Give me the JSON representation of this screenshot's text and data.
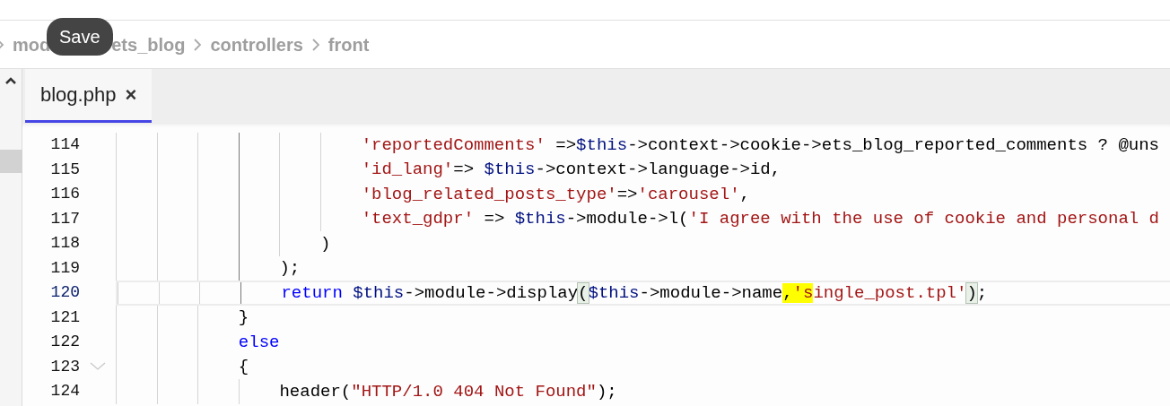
{
  "breadcrumb": [
    {
      "label": "mod"
    },
    {
      "label": "ets_blog"
    },
    {
      "label": "controllers"
    },
    {
      "label": "front"
    }
  ],
  "tooltip": "Save",
  "tabs": [
    {
      "label": "blog.php",
      "selected": true,
      "close": "×"
    }
  ],
  "code": {
    "lines": [
      {
        "number": "114",
        "current": false,
        "active_scope": true,
        "tokens": [
          {
            "kind": "string",
            "text": "                        'reportedComments'"
          },
          {
            "kind": "plain",
            "text": " =>"
          },
          {
            "kind": "variable",
            "text": "$this"
          },
          {
            "kind": "plain",
            "text": "->context->cookie->ets_blog_reported_comments ? @uns"
          }
        ]
      },
      {
        "number": "115",
        "current": false,
        "active_scope": true,
        "tokens": [
          {
            "kind": "string",
            "text": "                        'id_lang'"
          },
          {
            "kind": "plain",
            "text": "=> "
          },
          {
            "kind": "variable",
            "text": "$this"
          },
          {
            "kind": "plain",
            "text": "->context->language->id,"
          }
        ]
      },
      {
        "number": "116",
        "current": false,
        "active_scope": true,
        "tokens": [
          {
            "kind": "string",
            "text": "                        'blog_related_posts_type'"
          },
          {
            "kind": "plain",
            "text": "=>"
          },
          {
            "kind": "string",
            "text": "'carousel'"
          },
          {
            "kind": "plain",
            "text": ","
          }
        ]
      },
      {
        "number": "117",
        "current": false,
        "active_scope": true,
        "tokens": [
          {
            "kind": "string",
            "text": "                        'text_gdpr'"
          },
          {
            "kind": "plain",
            "text": " => "
          },
          {
            "kind": "variable",
            "text": "$this"
          },
          {
            "kind": "plain",
            "text": "->module->l("
          },
          {
            "kind": "string",
            "text": "'I agree with the use of cookie and personal d"
          }
        ]
      },
      {
        "number": "118",
        "current": false,
        "active_scope": true,
        "tokens": [
          {
            "kind": "plain",
            "text": "                    )"
          }
        ]
      },
      {
        "number": "119",
        "current": false,
        "active_scope": true,
        "tokens": [
          {
            "kind": "plain",
            "text": "                );"
          }
        ]
      },
      {
        "number": "120",
        "current": true,
        "active_scope": true,
        "tokens": [
          {
            "kind": "keyword",
            "text": "                return "
          },
          {
            "kind": "variable",
            "text": "$this"
          },
          {
            "kind": "plain",
            "text": "->module->display"
          },
          {
            "kind": "plain",
            "text": "(",
            "bracket_match": true
          },
          {
            "kind": "variable",
            "text": "$this"
          },
          {
            "kind": "plain",
            "text": "->module->name"
          },
          {
            "kind": "plain",
            "text": ",",
            "highlighted": true
          },
          {
            "kind": "string",
            "text": "'s",
            "highlighted": true
          },
          {
            "kind": "string",
            "text": "ingle_post.tpl'"
          },
          {
            "kind": "plain",
            "text": ")",
            "bracket_match": true
          },
          {
            "kind": "plain",
            "text": ";"
          }
        ]
      },
      {
        "number": "121",
        "current": false,
        "tokens": [
          {
            "kind": "plain",
            "text": "            }"
          }
        ]
      },
      {
        "number": "122",
        "current": false,
        "tokens": [
          {
            "kind": "keyword",
            "text": "            else"
          }
        ]
      },
      {
        "number": "123",
        "current": false,
        "foldable": true,
        "tokens": [
          {
            "kind": "plain",
            "text": "            {"
          }
        ]
      },
      {
        "number": "124",
        "current": false,
        "active_scope": false,
        "tokens": [
          {
            "kind": "plain",
            "text": "                header("
          },
          {
            "kind": "string",
            "text": "\"HTTP/1.0 404 Not Found\""
          },
          {
            "kind": "plain",
            "text": ");"
          }
        ]
      }
    ]
  }
}
